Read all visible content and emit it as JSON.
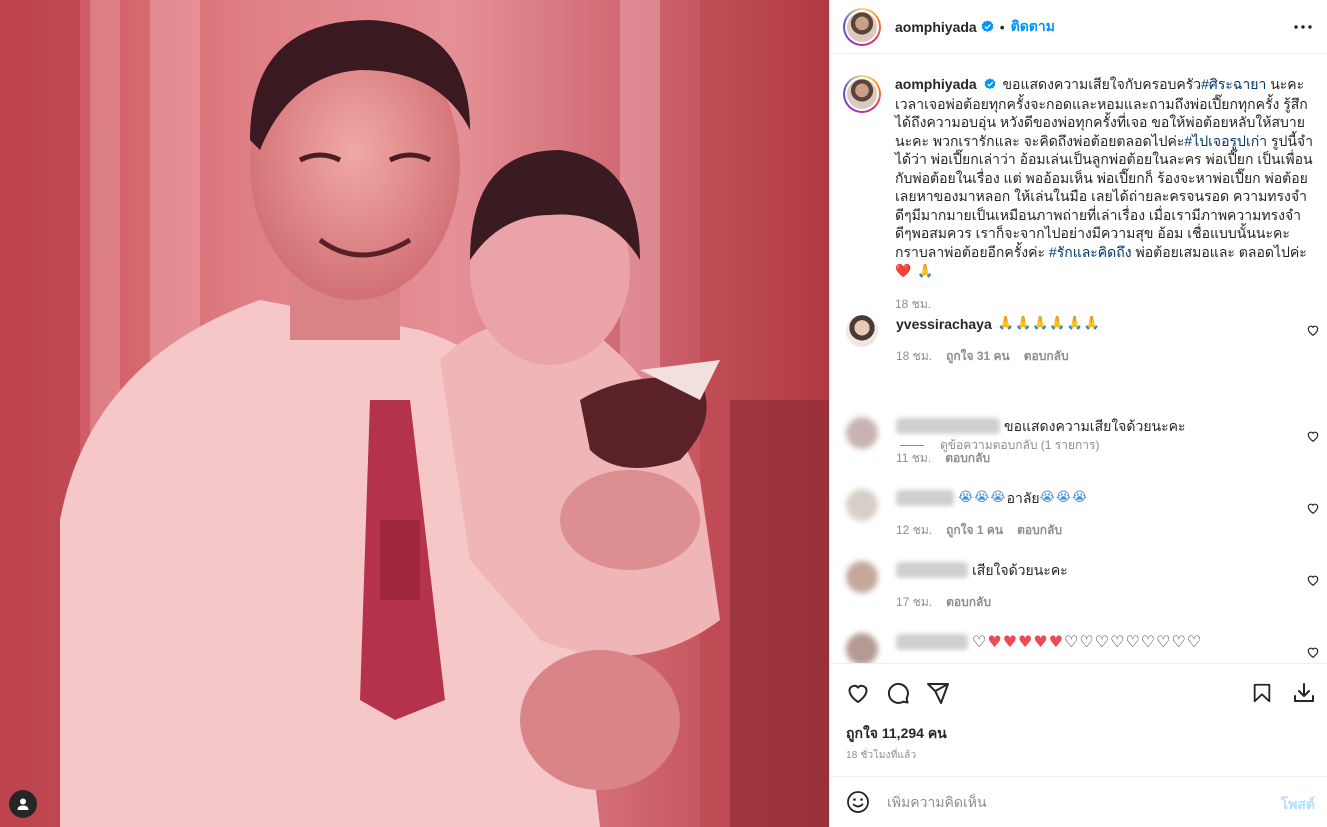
{
  "header": {
    "username": "aomphiyada",
    "separator": "•",
    "follow_label": "ติดตาม"
  },
  "caption": {
    "username": "aomphiyada",
    "part1": "ขอแสดงความเสียใจกับครอบครัว",
    "hashtag1": "#ศิระฉายา",
    "part2": " นะคะ เวลาเจอพ่อต้อยทุกครั้งจะกอดและหอมและถามถึงพ่อเปี๊ยกทุกครั้ง รู้สึกได้ถึงความอบอุ่น หวังดีของพ่อทุกครั้งที่เจอ ขอให้พ่อต้อยหลับให้สบายนะคะ พวกเรารักและ จะคิดถึงพ่อต้อยตลอดไปค่ะ",
    "hashtag2": "#ไปเจอรูปเก่า",
    "part3": " รูปนี้จำได้ว่า พ่อเปี๊ยกเล่าว่า อ้อมเล่นเป็นลูกพ่อต้อยในละคร พ่อเปี๊ยก เป็นเพื่อนกับพ่อต้อยในเรื่อง แต่ พออ้อมเห็น พ่อเปี๊ยกก็ ร้องจะหาพ่อเปี๊ยก พ่อต้อยเลยหาของมาหลอก ให้เล่นในมือ เลยได้ถ่ายละครจนรอด ความทรงจำดีๆมีมากมายเป็นเหมือนภาพถ่ายที่เล่าเรื่อง เมื่อเรามีภาพความทรงจำดีๆพอสมควร เราก็จะจากไปอย่างมีความสุข อ้อม เชื่อแบบนั้นนะคะ กราบลาพ่อต้อยอีกครั้งค่ะ ",
    "hashtag3": "#รักและคิดถึง",
    "part4": " พ่อต้อยเสมอและ ตลอดไปค่ะ ",
    "emoji_end": "❤️ 🙏",
    "time": "18 ชม."
  },
  "comments": [
    {
      "username": "yvessirachaya",
      "text": "🙏🙏🙏🙏🙏🙏",
      "time": "18 ชม.",
      "likes": "ถูกใจ 31 คน",
      "reply": "ตอบกลับ",
      "view_replies": "ดูข้อความตอบกลับ (1 รายการ)"
    },
    {
      "text": "ขอแสดงความเสียใจด้วยนะคะ",
      "time": "11 ชม.",
      "reply": "ตอบกลับ"
    },
    {
      "text_pre": "😭😭😭",
      "text_mid": "อาลัย",
      "text_post": "😭😭😭",
      "time": "12 ชม.",
      "likes": "ถูกใจ 1 คน",
      "reply": "ตอบกลับ"
    },
    {
      "text": "เสียใจด้วยนะคะ",
      "time": "17 ชม.",
      "reply": "ตอบกลับ"
    },
    {
      "text_white1": "♡",
      "text_red": "♥♥♥♥♥",
      "text_white2": "♡♡♡♡♡♡♡♡♡"
    }
  ],
  "actions": {
    "likes": "ถูกใจ 11,294 คน",
    "ago": "18 ชั่วโมงที่แล้ว"
  },
  "add_comment": {
    "placeholder": "เพิ่มความคิดเห็น",
    "post_label": "โพสต์"
  },
  "colors": {
    "brand_blue": "#0095f6",
    "hashtag": "#00376b",
    "muted": "#8e8e8e",
    "heart_red": "#ed4956",
    "photo_tint": "#d9676b"
  },
  "icons": [
    "verified-badge-icon",
    "more-options-icon",
    "heart-icon",
    "comment-icon",
    "share-icon",
    "save-icon",
    "download-icon",
    "emoji-icon",
    "user-tag-icon"
  ]
}
